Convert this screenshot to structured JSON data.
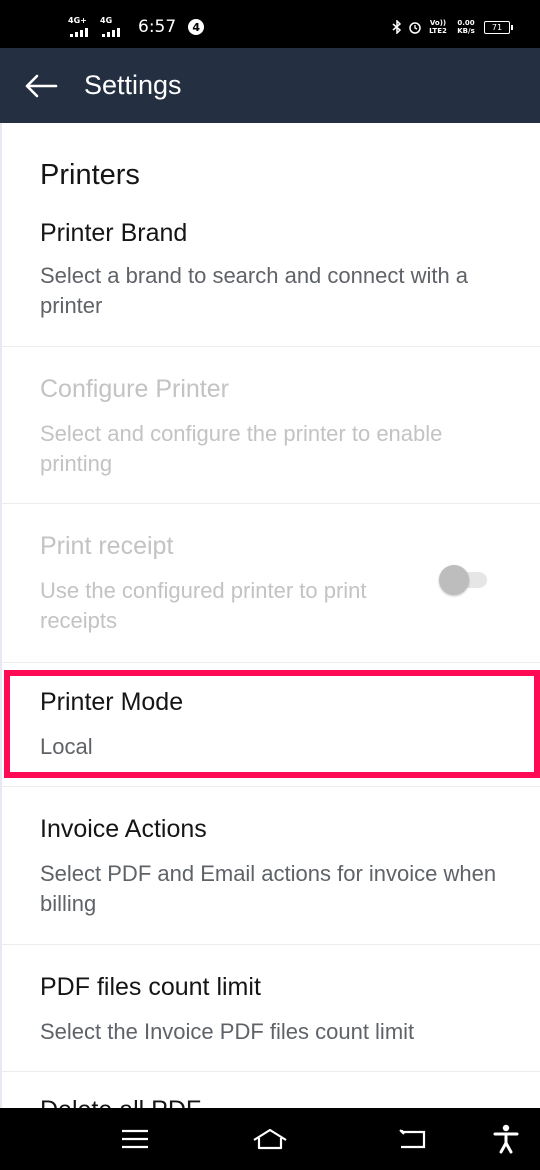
{
  "status_bar": {
    "net1": "4G+",
    "net2": "4G",
    "time": "6:57",
    "notification_count": "4",
    "volte": "Vo)) LTE2",
    "speed": "0.00 KB/s",
    "battery": "71"
  },
  "app_bar": {
    "title": "Settings",
    "back_icon": "arrow-left-icon"
  },
  "section": {
    "title": "Printers"
  },
  "preferences": [
    {
      "title": "Printer Brand",
      "summary": "Select a brand to search and connect with a printer",
      "enabled": true
    },
    {
      "title": "Configure Printer",
      "summary": "Select and configure the printer to enable printing",
      "enabled": false
    },
    {
      "title": "Print receipt",
      "summary": "Use the configured printer to print receipts",
      "enabled": false,
      "toggle": false
    },
    {
      "title": "Printer Mode",
      "summary": "Local",
      "enabled": true,
      "highlighted": true
    },
    {
      "title": "Invoice Actions",
      "summary": "Select PDF and Email actions for invoice when billing",
      "enabled": true
    },
    {
      "title": "PDF files count limit",
      "summary": "Select the Invoice PDF files count limit",
      "enabled": true
    },
    {
      "title": "Delete all PDF",
      "summary": "",
      "enabled": true
    }
  ],
  "nav_bar": {
    "icons": [
      "menu-icon",
      "home-icon",
      "back-icon",
      "accessibility-icon"
    ]
  },
  "colors": {
    "app_bar": "#243041",
    "highlight": "#ff0a55",
    "disabled_text": "#c3c3c3"
  }
}
